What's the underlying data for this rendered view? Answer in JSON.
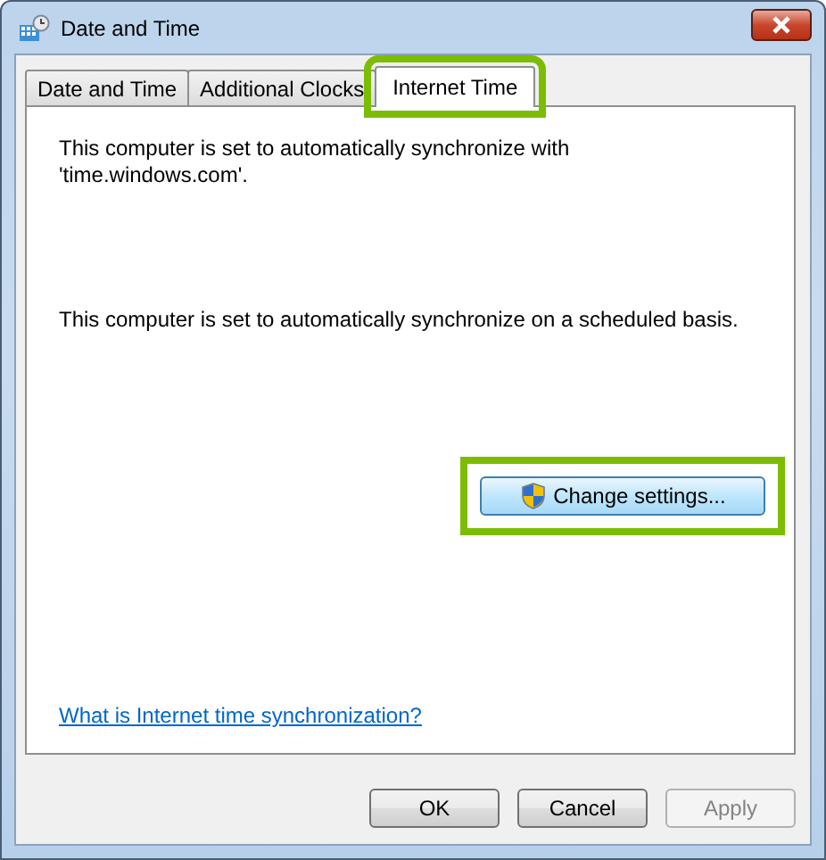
{
  "window": {
    "title": "Date and Time"
  },
  "tabs": [
    {
      "label": "Date and Time",
      "selected": false,
      "highlighted": false
    },
    {
      "label": "Additional Clocks",
      "selected": false,
      "highlighted": false
    },
    {
      "label": "Internet Time",
      "selected": true,
      "highlighted": true
    }
  ],
  "server_text": "This computer is set to automatically synchronize with 'time.windows.com'.",
  "schedule_text": "This computer is set to automatically synchronize on a scheduled basis.",
  "change_button": {
    "label": "Change settings...",
    "highlighted": true
  },
  "help_link": "What is Internet time synchronization?",
  "buttons": [
    {
      "label": "OK",
      "disabled": false
    },
    {
      "label": "Cancel",
      "disabled": false
    },
    {
      "label": "Apply",
      "disabled": true
    }
  ]
}
